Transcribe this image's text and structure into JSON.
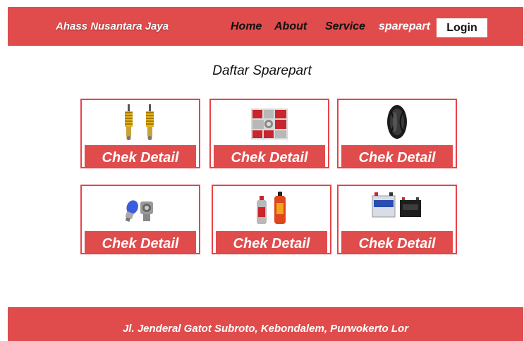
{
  "header": {
    "brand": "Ahass Nusantara Jaya",
    "nav": [
      "Home",
      "About",
      "Service",
      "sparepart"
    ],
    "login_label": "Login"
  },
  "main": {
    "title": "Daftar Sparepart",
    "cards": [
      {
        "image": "shock-absorber-image",
        "button": "Chek Detail"
      },
      {
        "image": "bearing-parts-image",
        "button": "Chek Detail"
      },
      {
        "image": "tire-image",
        "button": "Chek Detail"
      },
      {
        "image": "headlight-bulb-image",
        "button": "Chek Detail"
      },
      {
        "image": "oil-bottles-image",
        "button": "Chek Detail"
      },
      {
        "image": "battery-image",
        "button": "Chek Detail"
      }
    ]
  },
  "footer": {
    "address": "Jl. Jenderal Gatot Subroto, Kebondalem, Purwokerto Lor"
  },
  "colors": {
    "accent": "#e04c4c",
    "card_border": "#e8434a"
  }
}
